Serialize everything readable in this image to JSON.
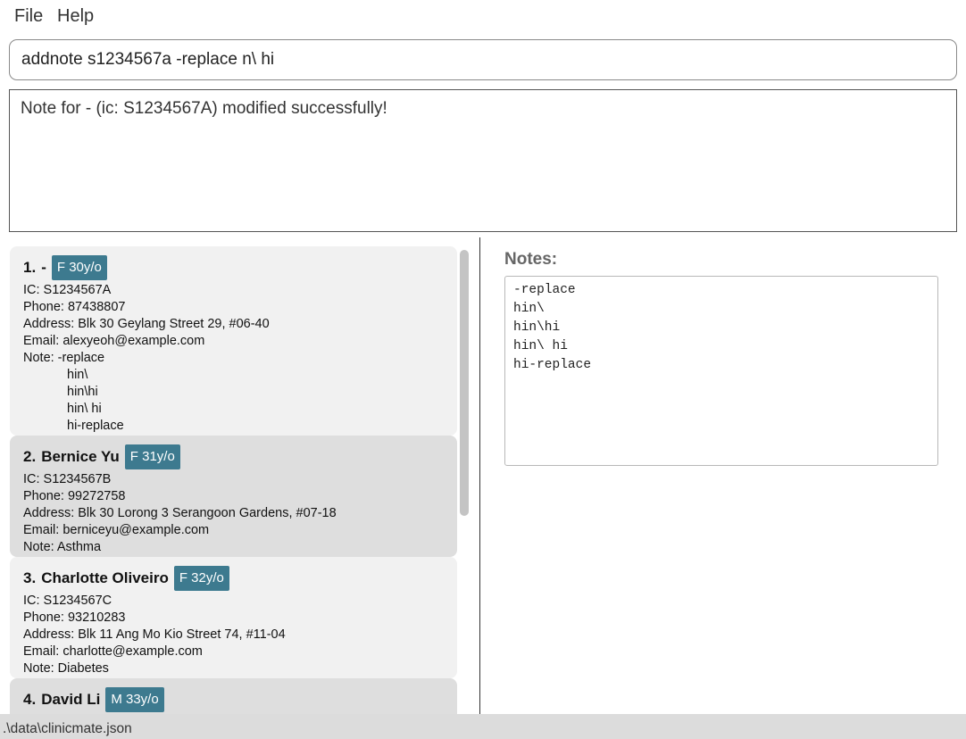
{
  "menu": {
    "file": "File",
    "help": "Help"
  },
  "command": {
    "value": "addnote s1234567a -replace n\\ hi"
  },
  "result": {
    "text": "Note for - (ic: S1234567A) modified successfully!"
  },
  "persons": [
    {
      "index": "1.",
      "name": "-",
      "badge": "F 30y/o",
      "ic": "IC: S1234567A",
      "phone": "Phone: 87438807",
      "address": "Address: Blk 30 Geylang Street 29, #06-40",
      "email": "Email: alexyeoh@example.com",
      "note_label": "Note: -replace",
      "note_lines": [
        "hin\\",
        "hin\\hi",
        "hin\\ hi",
        "hi-replace"
      ]
    },
    {
      "index": "2.",
      "name": "Bernice Yu",
      "badge": "F 31y/o",
      "ic": "IC: S1234567B",
      "phone": "Phone: 99272758",
      "address": "Address: Blk 30 Lorong 3 Serangoon Gardens, #07-18",
      "email": "Email: berniceyu@example.com",
      "note_label": "Note: Asthma"
    },
    {
      "index": "3.",
      "name": "Charlotte Oliveiro",
      "badge": "F 32y/o",
      "ic": "IC: S1234567C",
      "phone": "Phone: 93210283",
      "address": "Address: Blk 11 Ang Mo Kio Street 74, #11-04",
      "email": "Email: charlotte@example.com",
      "note_label": "Note: Diabetes"
    },
    {
      "index": "4.",
      "name": "David Li",
      "badge": "M 33y/o"
    }
  ],
  "notes_panel": {
    "title": "Notes:",
    "content": "-replace\nhin\\\nhin\\hi\nhin\\ hi\nhi-replace"
  },
  "status": {
    "path": ".\\data\\clinicmate.json"
  },
  "colors": {
    "badge": "#3d7a8f",
    "card_odd": "#f1f1f1",
    "card_even": "#dedede"
  }
}
